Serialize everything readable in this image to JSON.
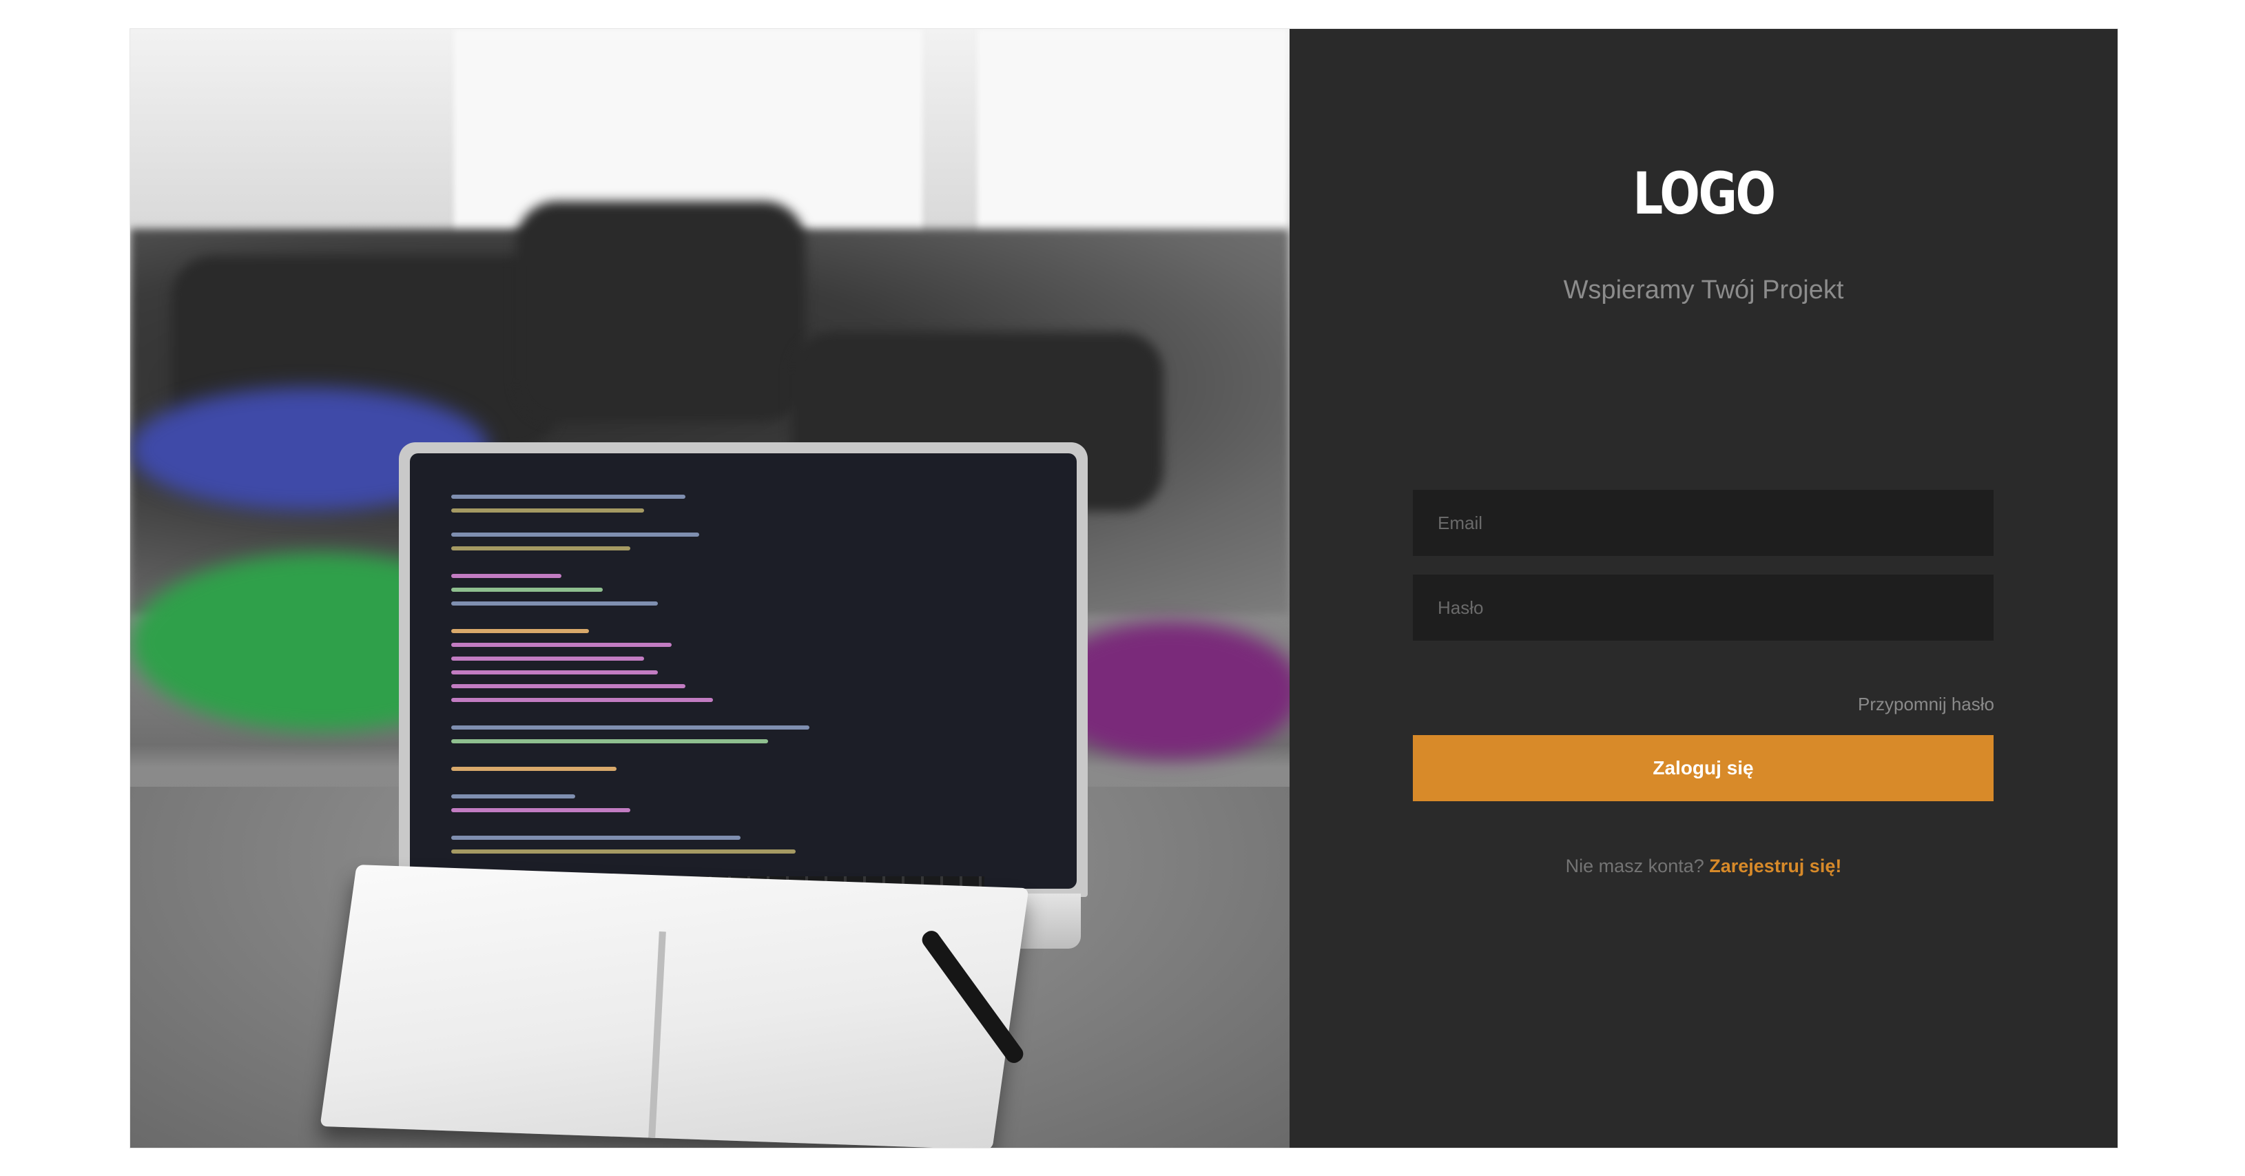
{
  "brand": {
    "logo": "LOGO",
    "tagline": "Wspieramy Twój Projekt"
  },
  "login_form": {
    "email_placeholder": "Email",
    "email_value": "",
    "password_placeholder": "Hasło",
    "password_value": "",
    "forgot_password_label": "Przypomnij hasło",
    "submit_label": "Zaloguj się"
  },
  "register": {
    "prompt": "Nie masz konta?",
    "link_label": "Zarejestruj się!"
  },
  "colors": {
    "panel_background": "#2a2a2a",
    "field_background": "#1e1e1e",
    "accent": "#d88a29",
    "page_background": "#ffffff"
  }
}
